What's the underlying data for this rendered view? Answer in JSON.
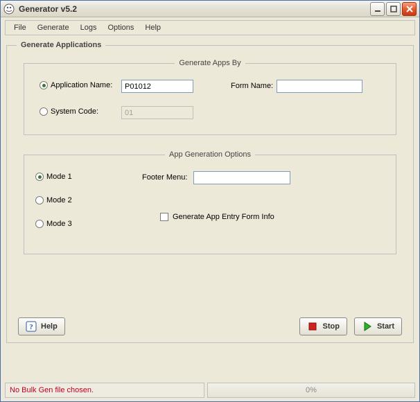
{
  "window": {
    "title": "Generator v5.2"
  },
  "menu": {
    "file": "File",
    "generate": "Generate",
    "logs": "Logs",
    "options": "Options",
    "help": "Help"
  },
  "outer": {
    "legend": "Generate Applications"
  },
  "genby": {
    "legend": "Generate Apps By",
    "appname_label": "Application Name:",
    "appname_value": "P01012",
    "formname_label": "Form Name:",
    "formname_value": "",
    "syscode_label": "System Code:",
    "syscode_value": "01",
    "selected": "appname"
  },
  "opts": {
    "legend": "App Generation Options",
    "mode1": "Mode 1",
    "mode2": "Mode 2",
    "mode3": "Mode 3",
    "mode_selected": "mode1",
    "footer_label": "Footer Menu:",
    "footer_value": "",
    "gen_entry_label": "Generate App Entry Form Info",
    "gen_entry_checked": false
  },
  "buttons": {
    "help": "Help",
    "stop": "Stop",
    "start": "Start"
  },
  "status": {
    "message": "No Bulk Gen file chosen.",
    "progress": "0%"
  }
}
